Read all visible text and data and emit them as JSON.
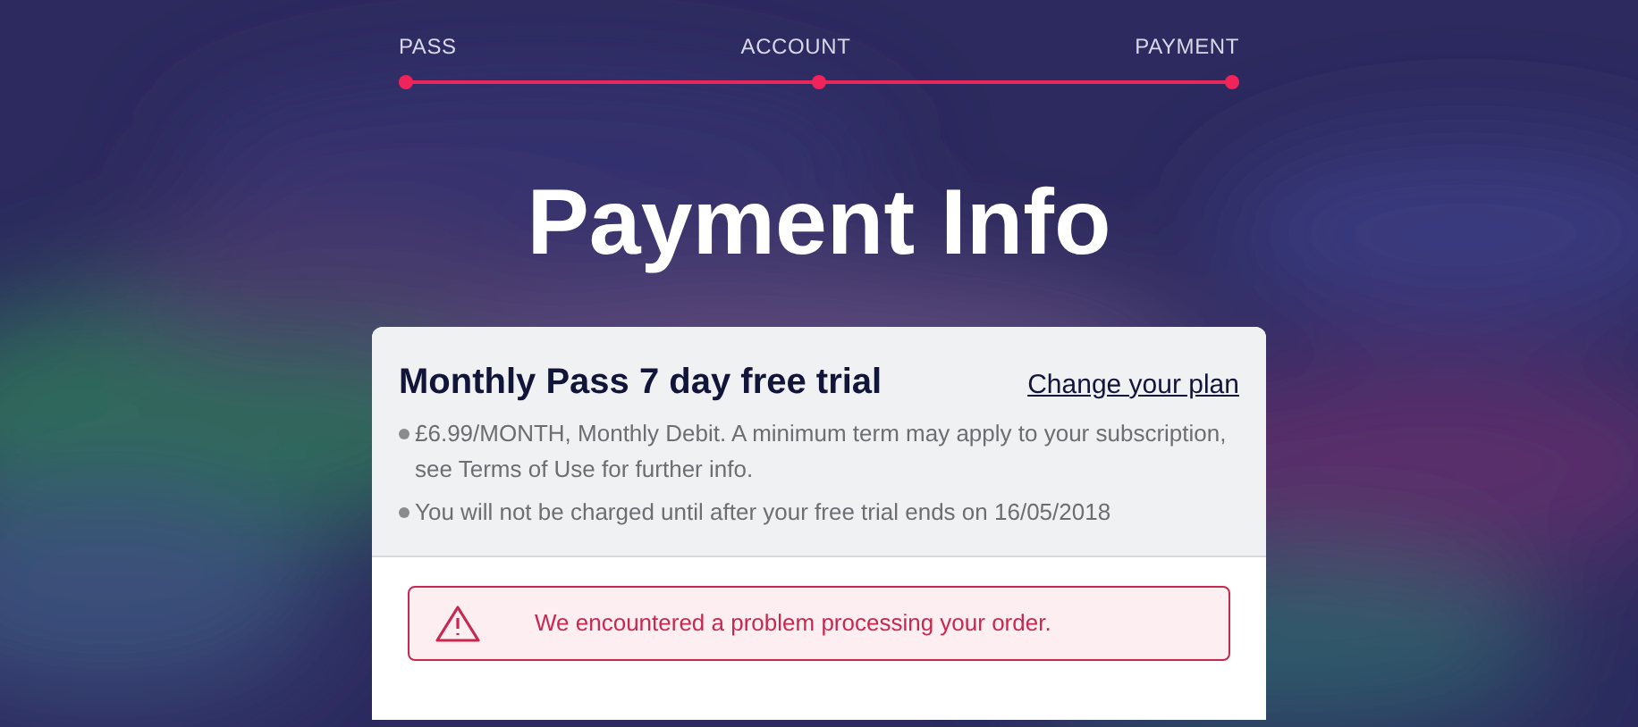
{
  "steps": [
    {
      "label": "PASS"
    },
    {
      "label": "ACCOUNT"
    },
    {
      "label": "PAYMENT"
    }
  ],
  "title": "Payment Info",
  "plan": {
    "name": "Monthly Pass 7 day free trial",
    "change_link": "Change your plan",
    "details": [
      "£6.99/MONTH, Monthly Debit. A minimum term may apply to your subscription, see Terms of Use for further info.",
      "You will not be charged until after your free trial ends on 16/05/2018"
    ]
  },
  "error": {
    "message": "We encountered a problem processing your order."
  }
}
